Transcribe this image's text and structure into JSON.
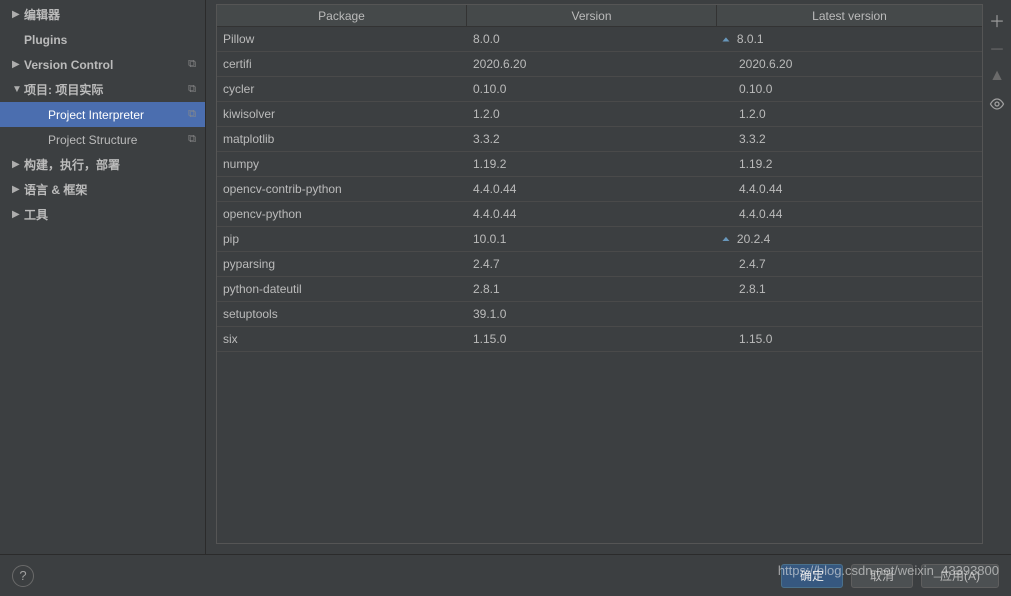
{
  "sidebar": {
    "items": [
      {
        "label": "编辑器",
        "arrow": "▶",
        "bold": true,
        "copy": false,
        "indent": false
      },
      {
        "label": "Plugins",
        "arrow": "",
        "bold": true,
        "copy": false,
        "indent": false
      },
      {
        "label": "Version Control",
        "arrow": "▶",
        "bold": true,
        "copy": true,
        "indent": false
      },
      {
        "label": "项目: 项目实际",
        "arrow": "▼",
        "bold": true,
        "copy": true,
        "indent": false
      },
      {
        "label": "Project Interpreter",
        "arrow": "",
        "bold": false,
        "copy": true,
        "indent": true,
        "selected": true
      },
      {
        "label": "Project Structure",
        "arrow": "",
        "bold": false,
        "copy": true,
        "indent": true
      },
      {
        "label": "构建，执行，部署",
        "arrow": "▶",
        "bold": true,
        "copy": false,
        "indent": false
      },
      {
        "label": "语言 & 框架",
        "arrow": "▶",
        "bold": true,
        "copy": false,
        "indent": false
      },
      {
        "label": "工具",
        "arrow": "▶",
        "bold": true,
        "copy": false,
        "indent": false
      }
    ]
  },
  "table": {
    "headers": {
      "package": "Package",
      "version": "Version",
      "latest": "Latest version"
    },
    "rows": [
      {
        "pkg": "Pillow",
        "ver": "8.0.0",
        "lat": "8.0.1",
        "upgrade": true
      },
      {
        "pkg": "certifi",
        "ver": "2020.6.20",
        "lat": "2020.6.20",
        "upgrade": false
      },
      {
        "pkg": "cycler",
        "ver": "0.10.0",
        "lat": "0.10.0",
        "upgrade": false
      },
      {
        "pkg": "kiwisolver",
        "ver": "1.2.0",
        "lat": "1.2.0",
        "upgrade": false
      },
      {
        "pkg": "matplotlib",
        "ver": "3.3.2",
        "lat": "3.3.2",
        "upgrade": false
      },
      {
        "pkg": "numpy",
        "ver": "1.19.2",
        "lat": "1.19.2",
        "upgrade": false
      },
      {
        "pkg": "opencv-contrib-python",
        "ver": "4.4.0.44",
        "lat": "4.4.0.44",
        "upgrade": false
      },
      {
        "pkg": "opencv-python",
        "ver": "4.4.0.44",
        "lat": "4.4.0.44",
        "upgrade": false
      },
      {
        "pkg": "pip",
        "ver": "10.0.1",
        "lat": "20.2.4",
        "upgrade": true
      },
      {
        "pkg": "pyparsing",
        "ver": "2.4.7",
        "lat": "2.4.7",
        "upgrade": false
      },
      {
        "pkg": "python-dateutil",
        "ver": "2.8.1",
        "lat": "2.8.1",
        "upgrade": false
      },
      {
        "pkg": "setuptools",
        "ver": "39.1.0",
        "lat": "",
        "upgrade": false
      },
      {
        "pkg": "six",
        "ver": "1.15.0",
        "lat": "1.15.0",
        "upgrade": false
      }
    ]
  },
  "footer": {
    "ok": "确定",
    "cancel": "取消",
    "apply": "应用(A)",
    "help": "?"
  },
  "watermark": "https://blog.csdn.net/weixin_43393800"
}
